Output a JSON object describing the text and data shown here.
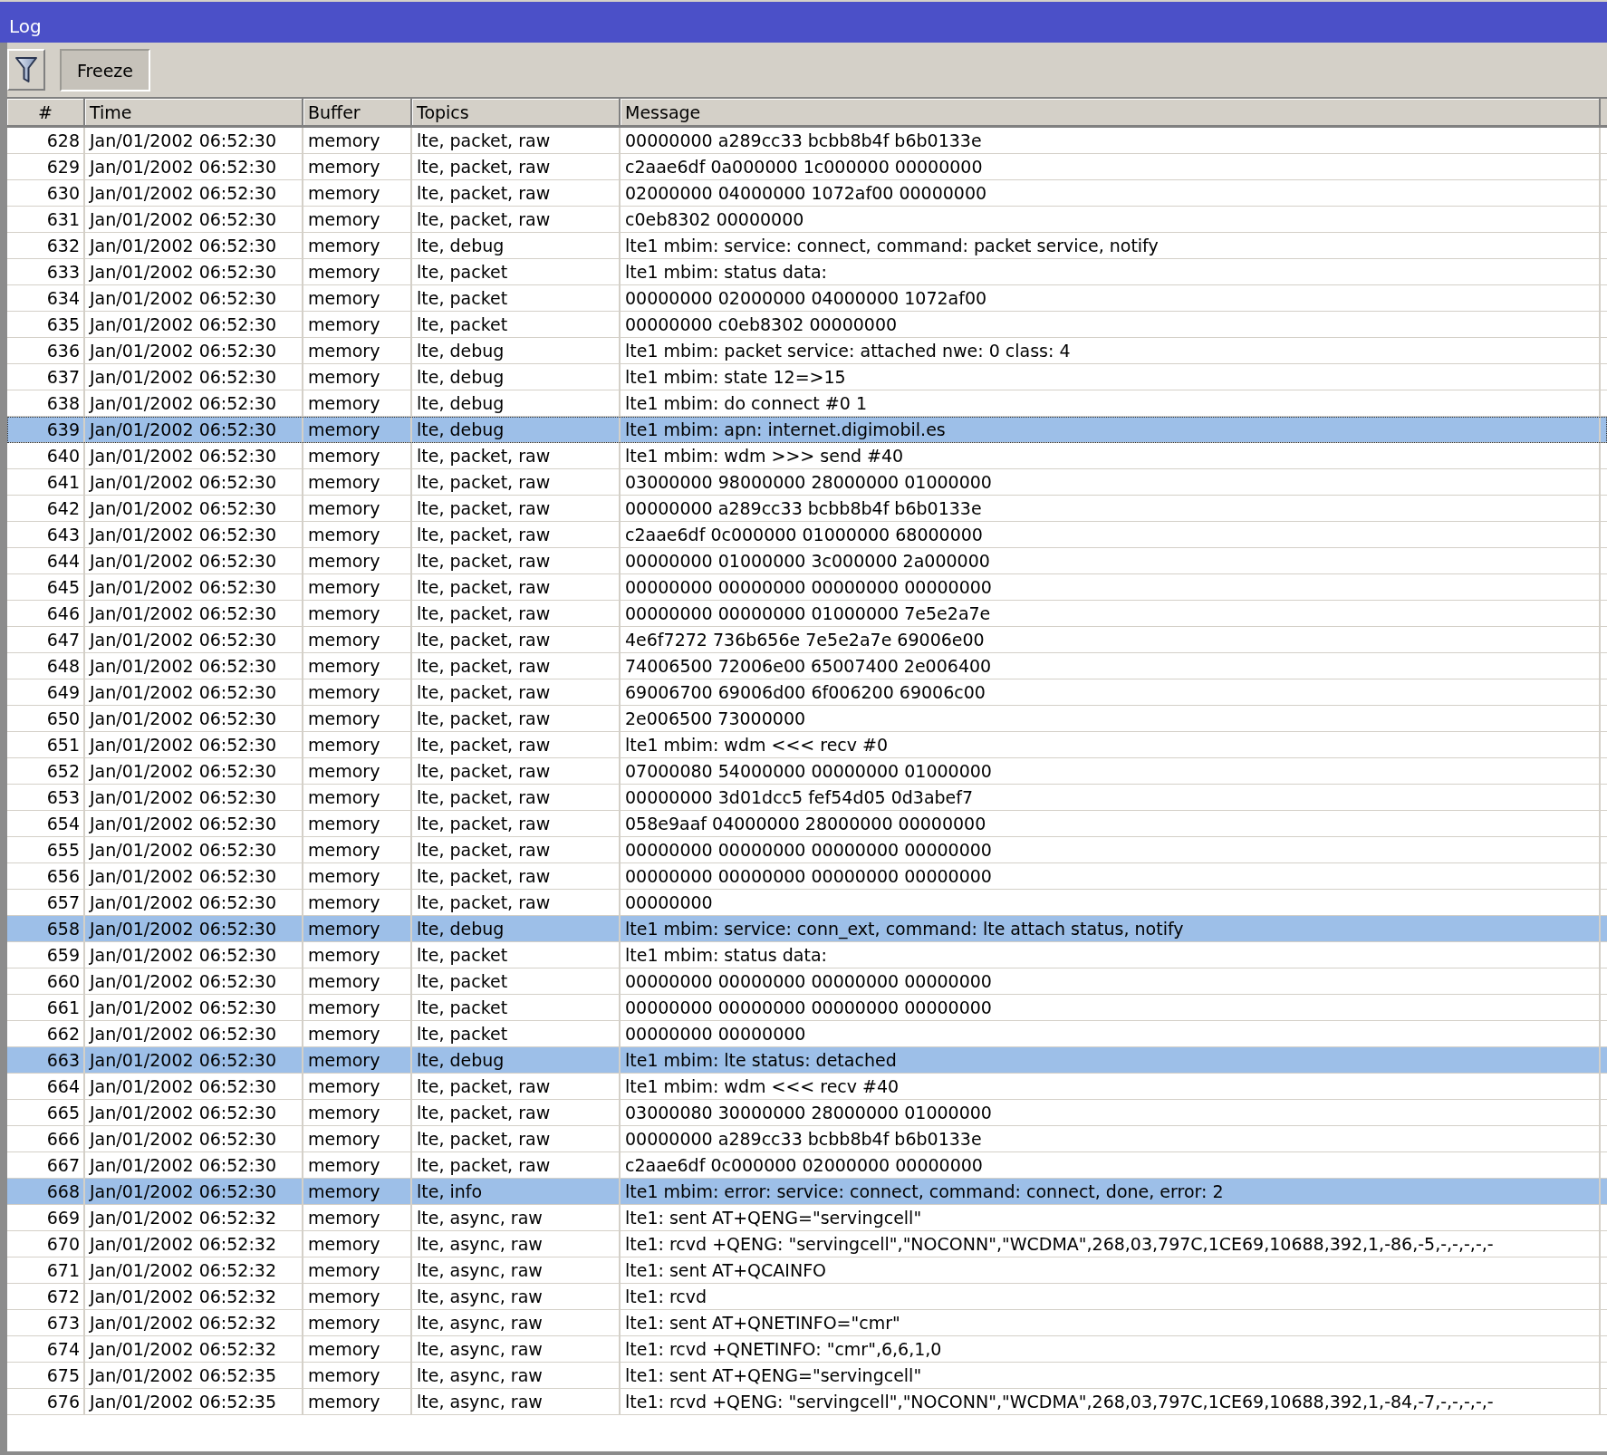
{
  "window": {
    "title": "Log"
  },
  "toolbar": {
    "freeze_label": "Freeze"
  },
  "table": {
    "columns": [
      "#",
      "Time",
      "Buffer",
      "Topics",
      "Message"
    ],
    "rows": [
      {
        "num": "628",
        "time": "Jan/01/2002 06:52:30",
        "buffer": "memory",
        "topics": "lte, packet, raw",
        "message": "00000000 a289cc33 bcbb8b4f b6b0133e",
        "selected": false,
        "focused": false
      },
      {
        "num": "629",
        "time": "Jan/01/2002 06:52:30",
        "buffer": "memory",
        "topics": "lte, packet, raw",
        "message": "c2aae6df 0a000000 1c000000 00000000",
        "selected": false,
        "focused": false
      },
      {
        "num": "630",
        "time": "Jan/01/2002 06:52:30",
        "buffer": "memory",
        "topics": "lte, packet, raw",
        "message": "02000000 04000000 1072af00 00000000",
        "selected": false,
        "focused": false
      },
      {
        "num": "631",
        "time": "Jan/01/2002 06:52:30",
        "buffer": "memory",
        "topics": "lte, packet, raw",
        "message": "c0eb8302 00000000",
        "selected": false,
        "focused": false
      },
      {
        "num": "632",
        "time": "Jan/01/2002 06:52:30",
        "buffer": "memory",
        "topics": "lte, debug",
        "message": "lte1 mbim: service: connect, command: packet service, notify",
        "selected": false,
        "focused": false
      },
      {
        "num": "633",
        "time": "Jan/01/2002 06:52:30",
        "buffer": "memory",
        "topics": "lte, packet",
        "message": "lte1 mbim: status data:",
        "selected": false,
        "focused": false
      },
      {
        "num": "634",
        "time": "Jan/01/2002 06:52:30",
        "buffer": "memory",
        "topics": "lte, packet",
        "message": "00000000 02000000 04000000 1072af00",
        "selected": false,
        "focused": false
      },
      {
        "num": "635",
        "time": "Jan/01/2002 06:52:30",
        "buffer": "memory",
        "topics": "lte, packet",
        "message": "00000000 c0eb8302 00000000",
        "selected": false,
        "focused": false
      },
      {
        "num": "636",
        "time": "Jan/01/2002 06:52:30",
        "buffer": "memory",
        "topics": "lte, debug",
        "message": "lte1 mbim: packet service: attached nwe: 0 class: 4",
        "selected": false,
        "focused": false
      },
      {
        "num": "637",
        "time": "Jan/01/2002 06:52:30",
        "buffer": "memory",
        "topics": "lte, debug",
        "message": "lte1 mbim: state 12=>15",
        "selected": false,
        "focused": false
      },
      {
        "num": "638",
        "time": "Jan/01/2002 06:52:30",
        "buffer": "memory",
        "topics": "lte, debug",
        "message": "lte1 mbim: do connect #0 1",
        "selected": false,
        "focused": false
      },
      {
        "num": "639",
        "time": "Jan/01/2002 06:52:30",
        "buffer": "memory",
        "topics": "lte, debug",
        "message": "lte1 mbim: apn: internet.digimobil.es",
        "selected": true,
        "focused": true
      },
      {
        "num": "640",
        "time": "Jan/01/2002 06:52:30",
        "buffer": "memory",
        "topics": "lte, packet, raw",
        "message": "lte1 mbim: wdm >>> send #40",
        "selected": false,
        "focused": false
      },
      {
        "num": "641",
        "time": "Jan/01/2002 06:52:30",
        "buffer": "memory",
        "topics": "lte, packet, raw",
        "message": "03000000 98000000 28000000 01000000",
        "selected": false,
        "focused": false
      },
      {
        "num": "642",
        "time": "Jan/01/2002 06:52:30",
        "buffer": "memory",
        "topics": "lte, packet, raw",
        "message": "00000000 a289cc33 bcbb8b4f b6b0133e",
        "selected": false,
        "focused": false
      },
      {
        "num": "643",
        "time": "Jan/01/2002 06:52:30",
        "buffer": "memory",
        "topics": "lte, packet, raw",
        "message": "c2aae6df 0c000000 01000000 68000000",
        "selected": false,
        "focused": false
      },
      {
        "num": "644",
        "time": "Jan/01/2002 06:52:30",
        "buffer": "memory",
        "topics": "lte, packet, raw",
        "message": "00000000 01000000 3c000000 2a000000",
        "selected": false,
        "focused": false
      },
      {
        "num": "645",
        "time": "Jan/01/2002 06:52:30",
        "buffer": "memory",
        "topics": "lte, packet, raw",
        "message": "00000000 00000000 00000000 00000000",
        "selected": false,
        "focused": false
      },
      {
        "num": "646",
        "time": "Jan/01/2002 06:52:30",
        "buffer": "memory",
        "topics": "lte, packet, raw",
        "message": "00000000 00000000 01000000 7e5e2a7e",
        "selected": false,
        "focused": false
      },
      {
        "num": "647",
        "time": "Jan/01/2002 06:52:30",
        "buffer": "memory",
        "topics": "lte, packet, raw",
        "message": "4e6f7272 736b656e 7e5e2a7e 69006e00",
        "selected": false,
        "focused": false
      },
      {
        "num": "648",
        "time": "Jan/01/2002 06:52:30",
        "buffer": "memory",
        "topics": "lte, packet, raw",
        "message": "74006500 72006e00 65007400 2e006400",
        "selected": false,
        "focused": false
      },
      {
        "num": "649",
        "time": "Jan/01/2002 06:52:30",
        "buffer": "memory",
        "topics": "lte, packet, raw",
        "message": "69006700 69006d00 6f006200 69006c00",
        "selected": false,
        "focused": false
      },
      {
        "num": "650",
        "time": "Jan/01/2002 06:52:30",
        "buffer": "memory",
        "topics": "lte, packet, raw",
        "message": "2e006500 73000000",
        "selected": false,
        "focused": false
      },
      {
        "num": "651",
        "time": "Jan/01/2002 06:52:30",
        "buffer": "memory",
        "topics": "lte, packet, raw",
        "message": "lte1 mbim: wdm <<< recv #0",
        "selected": false,
        "focused": false
      },
      {
        "num": "652",
        "time": "Jan/01/2002 06:52:30",
        "buffer": "memory",
        "topics": "lte, packet, raw",
        "message": "07000080 54000000 00000000 01000000",
        "selected": false,
        "focused": false
      },
      {
        "num": "653",
        "time": "Jan/01/2002 06:52:30",
        "buffer": "memory",
        "topics": "lte, packet, raw",
        "message": "00000000 3d01dcc5 fef54d05 0d3abef7",
        "selected": false,
        "focused": false
      },
      {
        "num": "654",
        "time": "Jan/01/2002 06:52:30",
        "buffer": "memory",
        "topics": "lte, packet, raw",
        "message": "058e9aaf 04000000 28000000 00000000",
        "selected": false,
        "focused": false
      },
      {
        "num": "655",
        "time": "Jan/01/2002 06:52:30",
        "buffer": "memory",
        "topics": "lte, packet, raw",
        "message": "00000000 00000000 00000000 00000000",
        "selected": false,
        "focused": false
      },
      {
        "num": "656",
        "time": "Jan/01/2002 06:52:30",
        "buffer": "memory",
        "topics": "lte, packet, raw",
        "message": "00000000 00000000 00000000 00000000",
        "selected": false,
        "focused": false
      },
      {
        "num": "657",
        "time": "Jan/01/2002 06:52:30",
        "buffer": "memory",
        "topics": "lte, packet, raw",
        "message": "00000000",
        "selected": false,
        "focused": false
      },
      {
        "num": "658",
        "time": "Jan/01/2002 06:52:30",
        "buffer": "memory",
        "topics": "lte, debug",
        "message": "lte1 mbim: service: conn_ext, command: lte attach status, notify",
        "selected": true,
        "focused": false
      },
      {
        "num": "659",
        "time": "Jan/01/2002 06:52:30",
        "buffer": "memory",
        "topics": "lte, packet",
        "message": "lte1 mbim: status data:",
        "selected": false,
        "focused": false
      },
      {
        "num": "660",
        "time": "Jan/01/2002 06:52:30",
        "buffer": "memory",
        "topics": "lte, packet",
        "message": "00000000 00000000 00000000 00000000",
        "selected": false,
        "focused": false
      },
      {
        "num": "661",
        "time": "Jan/01/2002 06:52:30",
        "buffer": "memory",
        "topics": "lte, packet",
        "message": "00000000 00000000 00000000 00000000",
        "selected": false,
        "focused": false
      },
      {
        "num": "662",
        "time": "Jan/01/2002 06:52:30",
        "buffer": "memory",
        "topics": "lte, packet",
        "message": "00000000 00000000",
        "selected": false,
        "focused": false
      },
      {
        "num": "663",
        "time": "Jan/01/2002 06:52:30",
        "buffer": "memory",
        "topics": "lte, debug",
        "message": "lte1 mbim: lte status: detached",
        "selected": true,
        "focused": false
      },
      {
        "num": "664",
        "time": "Jan/01/2002 06:52:30",
        "buffer": "memory",
        "topics": "lte, packet, raw",
        "message": "lte1 mbim: wdm <<< recv #40",
        "selected": false,
        "focused": false
      },
      {
        "num": "665",
        "time": "Jan/01/2002 06:52:30",
        "buffer": "memory",
        "topics": "lte, packet, raw",
        "message": "03000080 30000000 28000000 01000000",
        "selected": false,
        "focused": false
      },
      {
        "num": "666",
        "time": "Jan/01/2002 06:52:30",
        "buffer": "memory",
        "topics": "lte, packet, raw",
        "message": "00000000 a289cc33 bcbb8b4f b6b0133e",
        "selected": false,
        "focused": false
      },
      {
        "num": "667",
        "time": "Jan/01/2002 06:52:30",
        "buffer": "memory",
        "topics": "lte, packet, raw",
        "message": "c2aae6df 0c000000 02000000 00000000",
        "selected": false,
        "focused": false
      },
      {
        "num": "668",
        "time": "Jan/01/2002 06:52:30",
        "buffer": "memory",
        "topics": "lte, info",
        "message": "lte1 mbim: error: service: connect, command: connect, done, error: 2",
        "selected": true,
        "focused": false
      },
      {
        "num": "669",
        "time": "Jan/01/2002 06:52:32",
        "buffer": "memory",
        "topics": "lte, async, raw",
        "message": "lte1: sent AT+QENG=\"servingcell\"",
        "selected": false,
        "focused": false
      },
      {
        "num": "670",
        "time": "Jan/01/2002 06:52:32",
        "buffer": "memory",
        "topics": "lte, async, raw",
        "message": "lte1: rcvd +QENG: \"servingcell\",\"NOCONN\",\"WCDMA\",268,03,797C,1CE69,10688,392,1,-86,-5,-,-,-,-,-",
        "selected": false,
        "focused": false
      },
      {
        "num": "671",
        "time": "Jan/01/2002 06:52:32",
        "buffer": "memory",
        "topics": "lte, async, raw",
        "message": "lte1: sent AT+QCAINFO",
        "selected": false,
        "focused": false
      },
      {
        "num": "672",
        "time": "Jan/01/2002 06:52:32",
        "buffer": "memory",
        "topics": "lte, async, raw",
        "message": "lte1: rcvd",
        "selected": false,
        "focused": false
      },
      {
        "num": "673",
        "time": "Jan/01/2002 06:52:32",
        "buffer": "memory",
        "topics": "lte, async, raw",
        "message": "lte1: sent AT+QNETINFO=\"cmr\"",
        "selected": false,
        "focused": false
      },
      {
        "num": "674",
        "time": "Jan/01/2002 06:52:32",
        "buffer": "memory",
        "topics": "lte, async, raw",
        "message": "lte1: rcvd +QNETINFO: \"cmr\",6,6,1,0",
        "selected": false,
        "focused": false
      },
      {
        "num": "675",
        "time": "Jan/01/2002 06:52:35",
        "buffer": "memory",
        "topics": "lte, async, raw",
        "message": "lte1: sent AT+QENG=\"servingcell\"",
        "selected": false,
        "focused": false
      },
      {
        "num": "676",
        "time": "Jan/01/2002 06:52:35",
        "buffer": "memory",
        "topics": "lte, async, raw",
        "message": "lte1: rcvd +QENG: \"servingcell\",\"NOCONN\",\"WCDMA\",268,03,797C,1CE69,10688,392,1,-84,-7,-,-,-,-,-",
        "selected": false,
        "focused": false
      }
    ]
  }
}
